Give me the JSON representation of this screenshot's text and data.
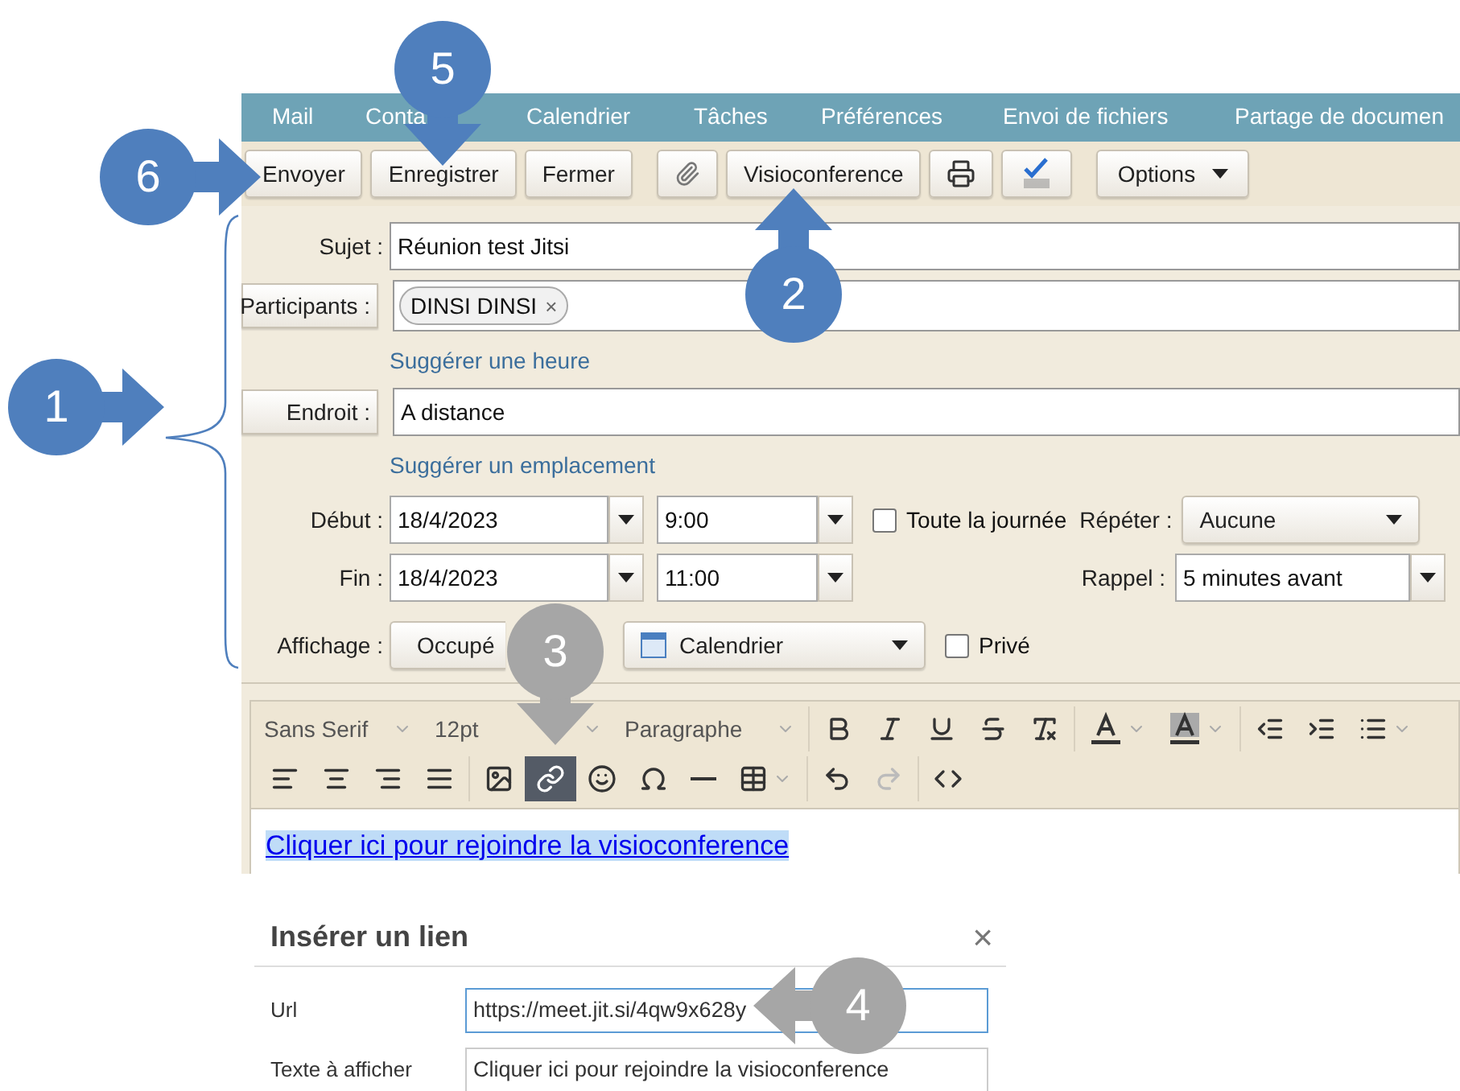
{
  "menu": [
    "Mail",
    "Conta",
    "Calendrier",
    "Tâches",
    "Préférences",
    "Envoi de fichiers",
    "Partage de documen"
  ],
  "toolbar": [
    {
      "kind": "button",
      "label": "Envoyer"
    },
    {
      "kind": "button",
      "label": "Enregistrer"
    },
    {
      "kind": "button",
      "label": "Fermer"
    },
    {
      "kind": "attach"
    },
    {
      "kind": "button",
      "label": "Visioconference"
    },
    {
      "kind": "print"
    },
    {
      "kind": "spellcheck"
    },
    {
      "kind": "menu",
      "label": "Options"
    }
  ],
  "form": {
    "subject": {
      "label": "Sujet :",
      "value": "Réunion test Jitsi"
    },
    "participants": {
      "label": "Participants :",
      "chips": [
        "DINSI DINSI"
      ],
      "chip_remove": "×"
    },
    "suggest_time": "Suggérer une heure",
    "location": {
      "label": "Endroit :",
      "value": "A distance"
    },
    "suggest_location": "Suggérer un emplacement",
    "start": {
      "label": "Début :",
      "date": "18/4/2023",
      "time": "9:00"
    },
    "all_day": {
      "label": "Toute la journée",
      "checked": false
    },
    "repeat": {
      "label": "Répéter :",
      "value": "Aucune"
    },
    "end": {
      "label": "Fin :",
      "date": "18/4/2023",
      "time": "11:00"
    },
    "reminder": {
      "label": "Rappel :",
      "value": "5 minutes avant"
    },
    "display": {
      "label": "Affichage :",
      "status": "Occupé",
      "calendar": "Calendrier"
    },
    "private": {
      "label": "Privé",
      "checked": false
    }
  },
  "editor": {
    "font": "Sans Serif",
    "size": "12pt",
    "block": "Paragraphe",
    "rows": [
      [
        [
          {
            "kind": "bold",
            "active": false,
            "disabled": false
          },
          {
            "kind": "italic",
            "active": false,
            "disabled": false
          },
          {
            "kind": "underline",
            "active": false,
            "disabled": false
          },
          {
            "kind": "strike",
            "active": false,
            "disabled": false
          },
          {
            "kind": "clear",
            "active": false,
            "disabled": false
          }
        ],
        [
          {
            "kind": "text-color",
            "active": false,
            "disabled": false
          },
          {
            "kind": "bg-color",
            "active": false,
            "disabled": false
          }
        ],
        [
          {
            "kind": "outdent",
            "active": false,
            "disabled": false
          },
          {
            "kind": "indent",
            "active": false,
            "disabled": false
          },
          {
            "kind": "list",
            "active": false,
            "disabled": false
          }
        ]
      ],
      [
        [
          {
            "kind": "align-left",
            "active": false,
            "disabled": false
          },
          {
            "kind": "align-center",
            "active": false,
            "disabled": false
          },
          {
            "kind": "align-right",
            "active": false,
            "disabled": false
          },
          {
            "kind": "justify",
            "active": false,
            "disabled": false
          }
        ],
        [
          {
            "kind": "image",
            "active": false,
            "disabled": false
          },
          {
            "kind": "link",
            "active": true,
            "disabled": false
          },
          {
            "kind": "emoji",
            "active": false,
            "disabled": false
          },
          {
            "kind": "omega",
            "active": false,
            "disabled": false
          },
          {
            "kind": "hr",
            "active": false,
            "disabled": false
          },
          {
            "kind": "table",
            "active": false,
            "disabled": false
          }
        ],
        [
          {
            "kind": "undo",
            "active": false,
            "disabled": false
          },
          {
            "kind": "redo",
            "active": false,
            "disabled": true
          }
        ],
        [
          {
            "kind": "code",
            "active": false,
            "disabled": false
          }
        ]
      ]
    ],
    "body_link": "Cliquer ici pour rejoindre la visioconference"
  },
  "dialog": {
    "title": "Insérer un lien",
    "close": "×",
    "fields": [
      {
        "label": "Url",
        "value": "https://meet.jit.si/4qw9x628y",
        "focused": true
      },
      {
        "label": "Texte à afficher",
        "value": "Cliquer ici pour rejoindre la visioconference",
        "focused": false
      }
    ]
  },
  "callouts": [
    {
      "number": "1",
      "color": "#4f7fbd"
    },
    {
      "number": "2",
      "color": "#4f7fbd"
    },
    {
      "number": "3",
      "color": "#a6a6a6"
    },
    {
      "number": "4",
      "color": "#a6a6a6"
    },
    {
      "number": "5",
      "color": "#4f7fbd"
    },
    {
      "number": "6",
      "color": "#4f7fbd"
    }
  ]
}
